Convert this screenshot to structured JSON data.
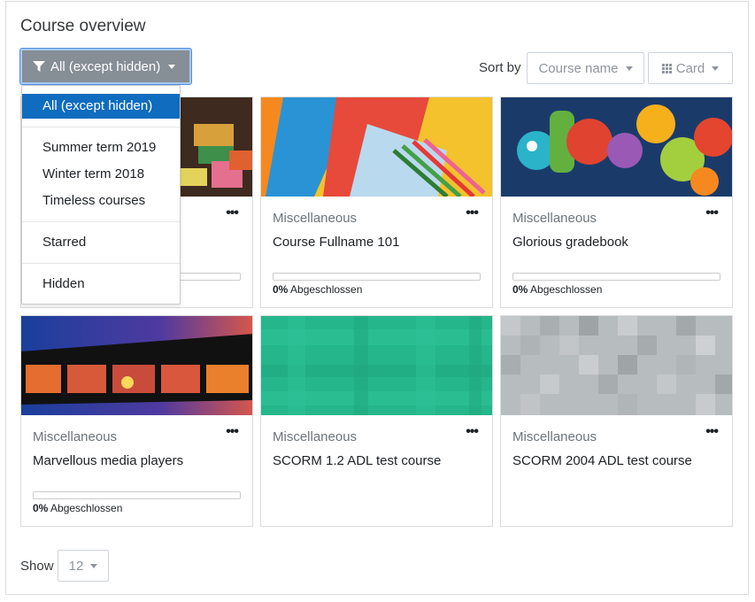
{
  "block": {
    "title": "Course overview"
  },
  "filter": {
    "selected": "All (except hidden)",
    "options": [
      "All (except hidden)",
      "Summer term 2019",
      "Winter term 2018",
      "Timeless courses",
      "Starred",
      "Hidden"
    ]
  },
  "sort": {
    "label": "Sort by",
    "value": "Course name"
  },
  "view": {
    "value": "Card"
  },
  "courses": [
    {
      "category": "",
      "name": "",
      "progress": "0%",
      "progress_label": ""
    },
    {
      "category": "Miscellaneous",
      "name": "Course Fullname 101",
      "progress": "0%",
      "progress_label": "Abgeschlossen"
    },
    {
      "category": "Miscellaneous",
      "name": "Glorious gradebook",
      "progress": "0%",
      "progress_label": "Abgeschlossen"
    },
    {
      "category": "Miscellaneous",
      "name": "Marvellous media players",
      "progress": "0%",
      "progress_label": "Abgeschlossen"
    },
    {
      "category": "Miscellaneous",
      "name": "SCORM 1.2 ADL test course"
    },
    {
      "category": "Miscellaneous",
      "name": "SCORM 2004 ADL test course"
    }
  ],
  "more_label": "•••",
  "show": {
    "label": "Show",
    "value": "12"
  },
  "colors": {
    "accent": "#0f6cbf",
    "filter_button": "#868e96"
  }
}
